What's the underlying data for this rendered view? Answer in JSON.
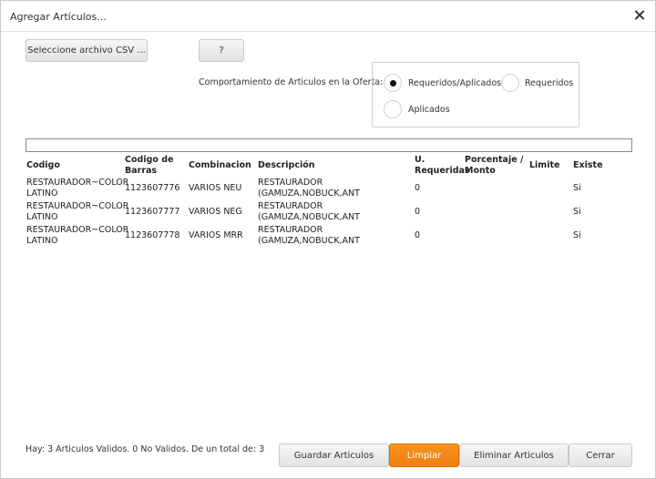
{
  "window": {
    "title": "Agregar Artículos..."
  },
  "toolbar": {
    "select_csv_label": "Seleccione archivo CSV ...",
    "help_label": "?"
  },
  "behavior": {
    "label": "Comportamiento de Articulos en la Oferta:",
    "options": [
      {
        "label": "Requeridos/Aplicados",
        "selected": true
      },
      {
        "label": "Requeridos",
        "selected": false
      },
      {
        "label": "Aplicados",
        "selected": false
      }
    ]
  },
  "progress": {
    "value": 0
  },
  "table": {
    "columns": [
      "Codigo",
      "Codigo de\nBarras",
      "Combinacion",
      "Descripción",
      "U.\nRequeridas",
      "Porcentaje /\nMonto",
      "Limite",
      "Existe"
    ],
    "rows": [
      {
        "codigo": "RESTAURADOR~COLOR\nLATINO",
        "barras": "1123607776",
        "combinacion": "VARIOS NEU",
        "descripcion": "RESTAURADOR\n(GAMUZA,NOBUCK,ANT",
        "u_requeridas": "0",
        "porcentaje": "",
        "limite": "",
        "existe": "Si"
      },
      {
        "codigo": "RESTAURADOR~COLOR\nLATINO",
        "barras": "1123607777",
        "combinacion": "VARIOS NEG",
        "descripcion": "RESTAURADOR\n(GAMUZA,NOBUCK,ANT",
        "u_requeridas": "0",
        "porcentaje": "",
        "limite": "",
        "existe": "Si"
      },
      {
        "codigo": "RESTAURADOR~COLOR\nLATINO",
        "barras": "1123607778",
        "combinacion": "VARIOS MRR",
        "descripcion": "RESTAURADOR\n(GAMUZA,NOBUCK,ANT",
        "u_requeridas": "0",
        "porcentaje": "",
        "limite": "",
        "existe": "Si"
      }
    ]
  },
  "footer": {
    "status": "Hay: 3 Articulos Validos. 0 No Validos. De un total de: 3",
    "save_label": "Guardar Articulos",
    "clear_label": "Limpiar",
    "delete_label": "Eliminar Articulos",
    "close_label": "Cerrar"
  },
  "colors": {
    "accent": "#f7931e",
    "border": "#c9c9c9"
  }
}
